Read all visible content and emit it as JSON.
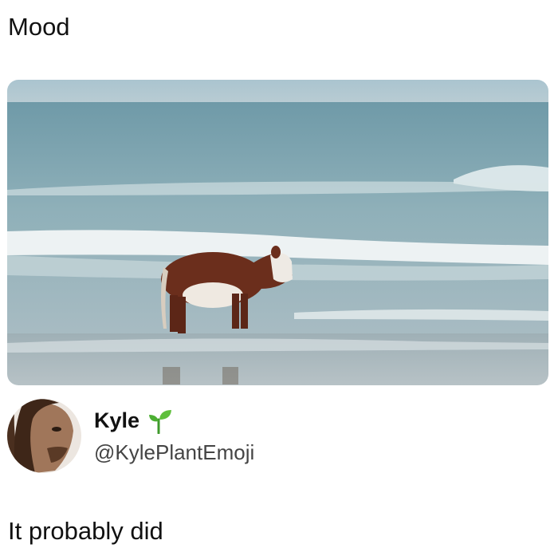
{
  "caption": "Mood",
  "image": {
    "alt_icon": "beach-cow-photo"
  },
  "author": {
    "name": "Kyle",
    "badge_icon": "sprout-icon",
    "handle": "@KylePlantEmoji"
  },
  "tweet": {
    "text": "It probably did"
  }
}
